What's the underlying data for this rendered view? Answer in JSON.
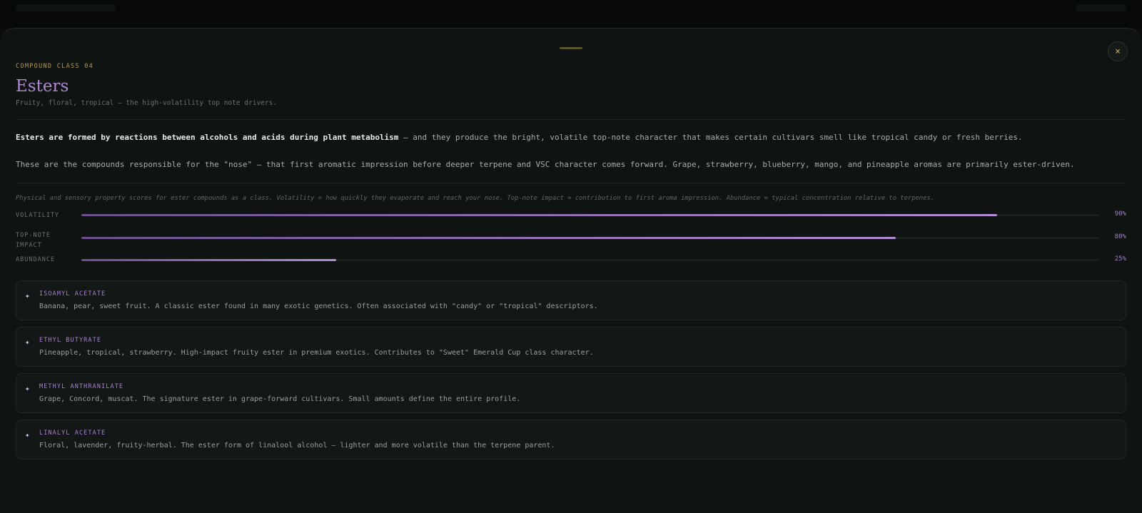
{
  "header": {
    "eyebrow": "COMPOUND CLASS 04",
    "title": "Esters",
    "subtitle": "Fruity, floral, tropical — the high-volatility top note drivers.",
    "close_icon": "×"
  },
  "body": {
    "intro_bold": "Esters are formed by reactions between alcohols and acids during plant metabolism",
    "intro_rest": " — and they produce the bright, volatile top-note character that makes certain cultivars smell like tropical candy or fresh berries.",
    "second_paragraph": "These are the compounds responsible for the \"nose\" — that first aromatic impression before deeper terpene and VSC character comes forward. Grape, strawberry, blueberry, mango, and pineapple aromas are primarily ester-driven."
  },
  "metrics": {
    "note": "Physical and sensory property scores for ester compounds as a class. Volatility = how quickly they evaporate and reach your nose. Top-note impact = contribution to first aroma impression. Abundance = typical concentration relative to terpenes.",
    "items": [
      {
        "label_line1": "VOLATILITY",
        "label_line2": "",
        "value": 90,
        "display": "90%"
      },
      {
        "label_line1": "TOP-NOTE",
        "label_line2": "IMPACT",
        "value": 80,
        "display": "80%"
      },
      {
        "label_line1": "ABUNDANCE",
        "label_line2": "",
        "value": 25,
        "display": "25%"
      }
    ],
    "bar_color": "#b48ad6"
  },
  "compounds": [
    {
      "icon": "sparkle-icon",
      "glyph": "✦",
      "name": "ISOAMYL ACETATE",
      "description": "Banana, pear, sweet fruit. A classic ester found in many exotic genetics. Often associated with \"candy\" or \"tropical\" descriptors."
    },
    {
      "icon": "sparkle-icon",
      "glyph": "✦",
      "name": "ETHYL BUTYRATE",
      "description": "Pineapple, tropical, strawberry. High-impact fruity ester in premium exotics. Contributes to \"Sweet\" Emerald Cup class character."
    },
    {
      "icon": "sparkle-icon",
      "glyph": "✦",
      "name": "METHYL ANTHRANILATE",
      "description": "Grape, Concord, muscat. The signature ester in grape-forward cultivars. Small amounts define the entire profile."
    },
    {
      "icon": "sparkle-icon",
      "glyph": "✦",
      "name": "LINALYL ACETATE",
      "description": "Floral, lavender, fruity-herbal. The ester form of linalool alcohol — lighter and more volatile than the terpene parent."
    }
  ],
  "colors": {
    "accent_gold": "#c9a35a",
    "accent_purple": "#b189d4",
    "background": "#0f1312"
  }
}
